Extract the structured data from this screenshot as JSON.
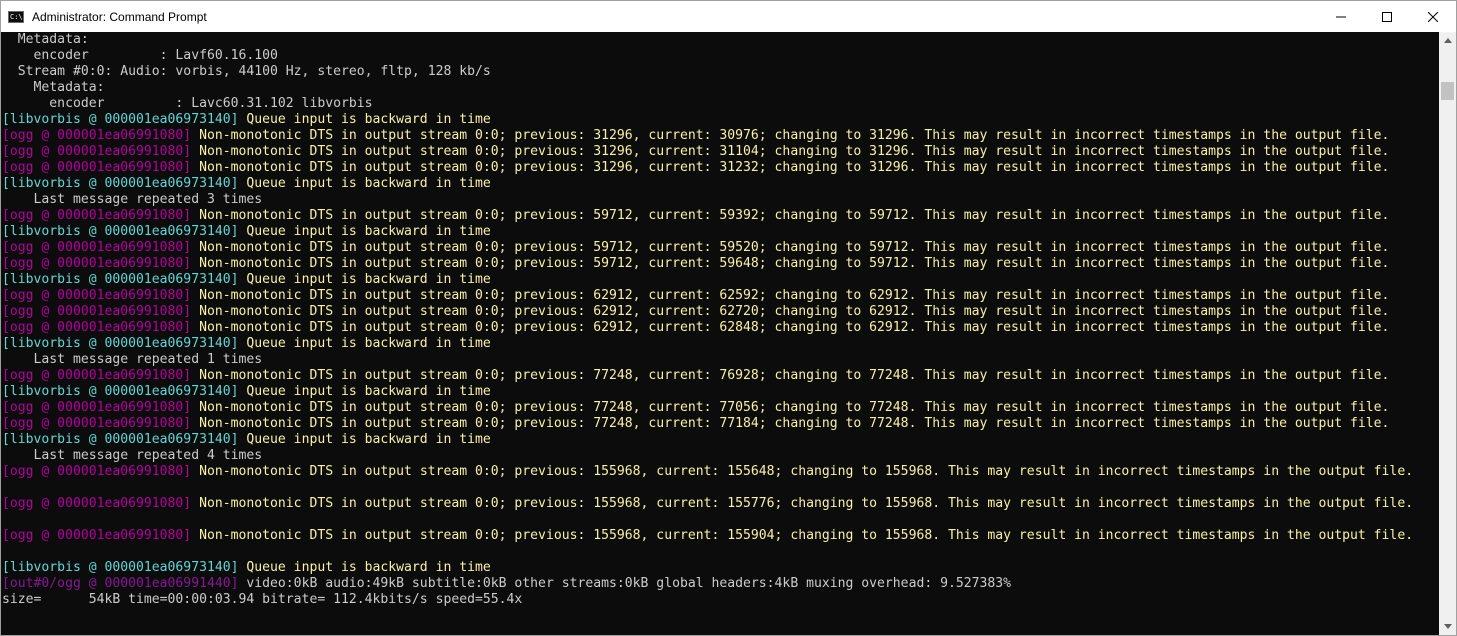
{
  "window": {
    "title": "Administrator: Command Prompt",
    "icon_glyph": "C:\\"
  },
  "icons": {
    "app": "cmd-icon",
    "minimize": "minimize-icon",
    "maximize": "maximize-icon",
    "close": "close-icon"
  },
  "colors": {
    "console_bg": "#0c0c0c",
    "text": "#cccccc",
    "libvorbis_tag": "#61d6d6",
    "ogg_tag": "#b4009e",
    "warning": "#f9f1a5"
  },
  "console": {
    "lines": [
      [
        {
          "t": "  Metadata:",
          "c": "msg"
        }
      ],
      [
        {
          "t": "    encoder         : Lavf60.16.100",
          "c": "msg"
        }
      ],
      [
        {
          "t": "  Stream #0:0: Audio: vorbis, 44100 Hz, stereo, fltp, 128 kb/s",
          "c": "msg"
        }
      ],
      [
        {
          "t": "    Metadata:",
          "c": "msg"
        }
      ],
      [
        {
          "t": "      encoder         : Lavc60.31.102 libvorbis",
          "c": "msg"
        }
      ],
      [
        {
          "t": "[libvorbis @ 000001ea06973140]",
          "c": "libv"
        },
        {
          "t": " Queue input is backward in time",
          "c": "yellow"
        }
      ],
      [
        {
          "t": "[ogg @ 000001ea06991080]",
          "c": "ogg"
        },
        {
          "t": " Non-monotonic DTS in output stream 0:0; previous: 31296, current: 30976; changing to 31296. This may result in incorrect timestamps in the output file.",
          "c": "yellow"
        }
      ],
      [
        {
          "t": "[ogg @ 000001ea06991080]",
          "c": "ogg"
        },
        {
          "t": " Non-monotonic DTS in output stream 0:0; previous: 31296, current: 31104; changing to 31296. This may result in incorrect timestamps in the output file.",
          "c": "yellow"
        }
      ],
      [
        {
          "t": "[ogg @ 000001ea06991080]",
          "c": "ogg"
        },
        {
          "t": " Non-monotonic DTS in output stream 0:0; previous: 31296, current: 31232; changing to 31296. This may result in incorrect timestamps in the output file.",
          "c": "yellow"
        }
      ],
      [
        {
          "t": "[libvorbis @ 000001ea06973140]",
          "c": "libv"
        },
        {
          "t": " Queue input is backward in time",
          "c": "yellow"
        }
      ],
      [
        {
          "t": "    Last message repeated 3 times",
          "c": "msg"
        }
      ],
      [
        {
          "t": "[ogg @ 000001ea06991080]",
          "c": "ogg"
        },
        {
          "t": " Non-monotonic DTS in output stream 0:0; previous: 59712, current: 59392; changing to 59712. This may result in incorrect timestamps in the output file.",
          "c": "yellow"
        }
      ],
      [
        {
          "t": "[libvorbis @ 000001ea06973140]",
          "c": "libv"
        },
        {
          "t": " Queue input is backward in time",
          "c": "yellow"
        }
      ],
      [
        {
          "t": "[ogg @ 000001ea06991080]",
          "c": "ogg"
        },
        {
          "t": " Non-monotonic DTS in output stream 0:0; previous: 59712, current: 59520; changing to 59712. This may result in incorrect timestamps in the output file.",
          "c": "yellow"
        }
      ],
      [
        {
          "t": "[ogg @ 000001ea06991080]",
          "c": "ogg"
        },
        {
          "t": " Non-monotonic DTS in output stream 0:0; previous: 59712, current: 59648; changing to 59712. This may result in incorrect timestamps in the output file.",
          "c": "yellow"
        }
      ],
      [
        {
          "t": "[libvorbis @ 000001ea06973140]",
          "c": "libv"
        },
        {
          "t": " Queue input is backward in time",
          "c": "yellow"
        }
      ],
      [
        {
          "t": "[ogg @ 000001ea06991080]",
          "c": "ogg"
        },
        {
          "t": " Non-monotonic DTS in output stream 0:0; previous: 62912, current: 62592; changing to 62912. This may result in incorrect timestamps in the output file.",
          "c": "yellow"
        }
      ],
      [
        {
          "t": "[ogg @ 000001ea06991080]",
          "c": "ogg"
        },
        {
          "t": " Non-monotonic DTS in output stream 0:0; previous: 62912, current: 62720; changing to 62912. This may result in incorrect timestamps in the output file.",
          "c": "yellow"
        }
      ],
      [
        {
          "t": "[ogg @ 000001ea06991080]",
          "c": "ogg"
        },
        {
          "t": " Non-monotonic DTS in output stream 0:0; previous: 62912, current: 62848; changing to 62912. This may result in incorrect timestamps in the output file.",
          "c": "yellow"
        }
      ],
      [
        {
          "t": "[libvorbis @ 000001ea06973140]",
          "c": "libv"
        },
        {
          "t": " Queue input is backward in time",
          "c": "yellow"
        }
      ],
      [
        {
          "t": "    Last message repeated 1 times",
          "c": "msg"
        }
      ],
      [
        {
          "t": "[ogg @ 000001ea06991080]",
          "c": "ogg"
        },
        {
          "t": " Non-monotonic DTS in output stream 0:0; previous: 77248, current: 76928; changing to 77248. This may result in incorrect timestamps in the output file.",
          "c": "yellow"
        }
      ],
      [
        {
          "t": "[libvorbis @ 000001ea06973140]",
          "c": "libv"
        },
        {
          "t": " Queue input is backward in time",
          "c": "yellow"
        }
      ],
      [
        {
          "t": "[ogg @ 000001ea06991080]",
          "c": "ogg"
        },
        {
          "t": " Non-monotonic DTS in output stream 0:0; previous: 77248, current: 77056; changing to 77248. This may result in incorrect timestamps in the output file.",
          "c": "yellow"
        }
      ],
      [
        {
          "t": "[ogg @ 000001ea06991080]",
          "c": "ogg"
        },
        {
          "t": " Non-monotonic DTS in output stream 0:0; previous: 77248, current: 77184; changing to 77248. This may result in incorrect timestamps in the output file.",
          "c": "yellow"
        }
      ],
      [
        {
          "t": "[libvorbis @ 000001ea06973140]",
          "c": "libv"
        },
        {
          "t": " Queue input is backward in time",
          "c": "yellow"
        }
      ],
      [
        {
          "t": "    Last message repeated 4 times",
          "c": "msg"
        }
      ],
      [
        {
          "t": "[ogg @ 000001ea06991080]",
          "c": "ogg"
        },
        {
          "t": " Non-monotonic DTS in output stream 0:0; previous: 155968, current: 155648; changing to 155968. This may result in incorrect timestamps in the output file.",
          "c": "yellow"
        }
      ],
      [],
      [
        {
          "t": "[ogg @ 000001ea06991080]",
          "c": "ogg"
        },
        {
          "t": " Non-monotonic DTS in output stream 0:0; previous: 155968, current: 155776; changing to 155968. This may result in incorrect timestamps in the output file.",
          "c": "yellow"
        }
      ],
      [],
      [
        {
          "t": "[ogg @ 000001ea06991080]",
          "c": "ogg"
        },
        {
          "t": " Non-monotonic DTS in output stream 0:0; previous: 155968, current: 155904; changing to 155968. This may result in incorrect timestamps in the output file.",
          "c": "yellow"
        }
      ],
      [],
      [
        {
          "t": "[libvorbis @ 000001ea06973140]",
          "c": "libv"
        },
        {
          "t": " Queue input is backward in time",
          "c": "yellow"
        }
      ],
      [
        {
          "t": "[out#0/ogg @ 000001ea06991440]",
          "c": "out"
        },
        {
          "t": " video:0kB audio:49kB subtitle:0kB other streams:0kB global headers:4kB muxing overhead: 9.527383%",
          "c": "msg"
        }
      ],
      [
        {
          "t": "size=      54kB time=00:00:03.94 bitrate= 112.4kbits/s speed=55.4x",
          "c": "msg"
        }
      ]
    ]
  }
}
